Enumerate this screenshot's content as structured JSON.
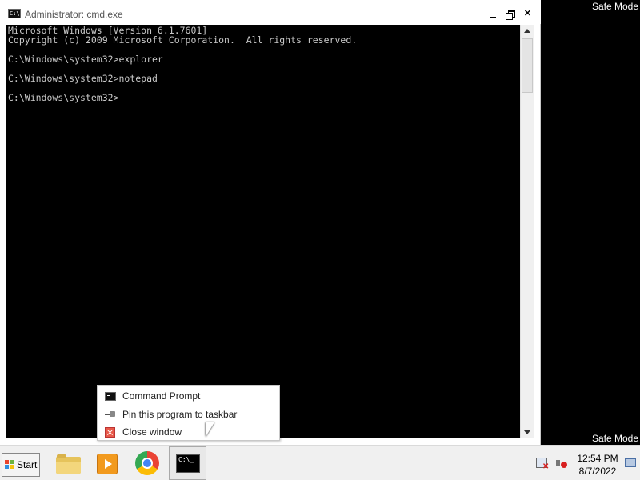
{
  "desktop": {
    "safe_mode_label": "Safe Mode"
  },
  "window": {
    "title": "Administrator: cmd.exe",
    "icon_text": "C:\\",
    "buttons": {
      "minimize": "minimize-icon",
      "maximize": "restore-icon",
      "close": "✕"
    }
  },
  "console": {
    "lines": [
      "Microsoft Windows [Version 6.1.7601]",
      "Copyright (c) 2009 Microsoft Corporation.  All rights reserved.",
      "",
      "C:\\Windows\\system32>explorer",
      "",
      "C:\\Windows\\system32>notepad",
      "",
      "C:\\Windows\\system32>"
    ]
  },
  "jumplist": {
    "items": [
      {
        "label": "Command Prompt",
        "icon": "cmd-icon"
      },
      {
        "label": "Pin this program to taskbar",
        "icon": "pin-icon"
      },
      {
        "label": "Close window",
        "icon": "close-icon"
      }
    ]
  },
  "taskbar": {
    "start_label": "Start",
    "apps": [
      "windows-explorer-icon",
      "media-player-icon",
      "chrome-icon",
      "command-prompt-icon"
    ],
    "cmd_icon_text": "C:\\_"
  },
  "clock": {
    "time": "12:54 PM",
    "date": "8/7/2022"
  }
}
